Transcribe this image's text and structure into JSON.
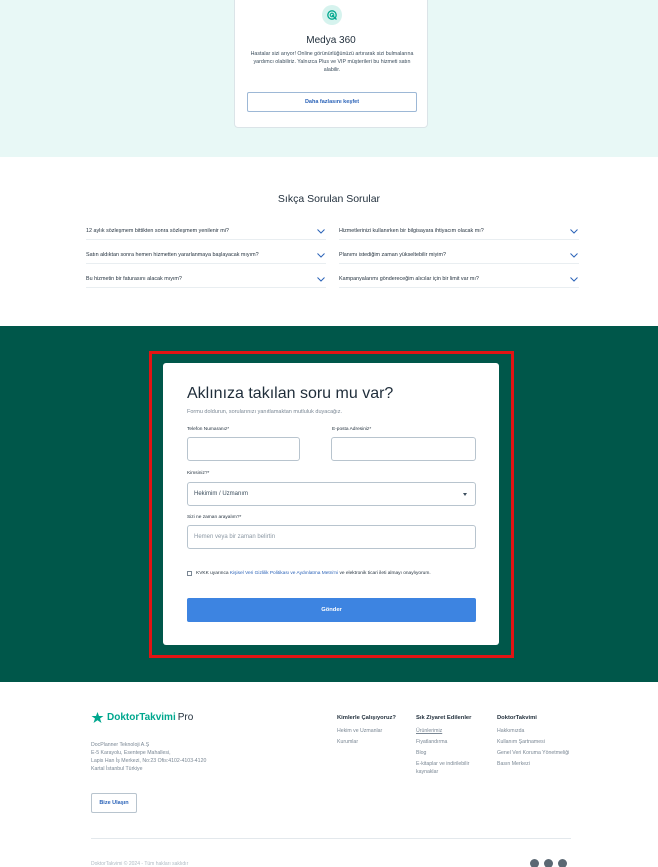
{
  "medya": {
    "icon": "radar-icon",
    "title": "Medya 360",
    "description": "Hastalar sizi arıyor! Online görünürlüğünüzü artırarak sizi bulmalarına yardımcı olabiliriz. Yalnızca Plus ve VIP müşterileri bu hizmeti satın alabilir.",
    "button": "Daha fazlasını keşfet"
  },
  "faq": {
    "title": "Sıkça Sorulan Sorular",
    "left": [
      "12 aylık sözleşmem bittikten sonra sözleşmem yenilenir mi?",
      "Satın aldıktan sonra hemen hizmetten yararlanmaya başlayacak mıyım?",
      "Bu hizmetin bir faturasını alacak mıyım?"
    ],
    "right": [
      "Hizmetlerinizi kullanırken bir bilgisayara ihtiyacım olacak mı?",
      "Planımı istediğim zaman yükseltebilir miyim?",
      "Kampanyalarımı göndereceğim alıcılar için bir limit var mı?"
    ]
  },
  "form": {
    "title": "Aklınıza takılan soru mu var?",
    "subtitle": "Formu doldurun, sorularınızı yanıtlamaktan mutluluk duyacağız.",
    "phone_label": "Telefon Numaranız*",
    "email_label": "E-posta Adresiniz*",
    "phone_value": "",
    "email_value": "",
    "who_label": "Kimsiniz?*",
    "who_value": "Hekimim / Uzmanım",
    "when_label": "Sizi ne zaman arayalım?*",
    "when_placeholder": "Hemen veya bir zaman belirtin",
    "kvkk_prefix": "KVKK uyarınca",
    "kvkk_link": "Kişisel Veri Gizlilik Politikası ve Aydınlatma Metni'ni",
    "kvkk_suffix": "ve elektronik ticari ileti almayı onaylıyorum.",
    "submit": "Gönder"
  },
  "footer": {
    "brand": "DoktorTakvimi",
    "brand_suffix": "Pro",
    "address": [
      "DocPlanner Teknoloji A.Ş",
      "E-5 Karayolu, Esentepe Mahallesi,",
      "Lapis Han İş Merkezi, No:23 Ofis:4102-4103-4120",
      "Kartal İstanbul Türkiye"
    ],
    "contact_button": "Bize Ulaşın",
    "col1": {
      "title": "Kimlerle Çalışıyoruz?",
      "items": [
        "Hekim ve Uzmanlar",
        "Kurumlar"
      ]
    },
    "col2": {
      "title": "Sık Ziyaret Edilenler",
      "items": [
        "Ürünlerimiz",
        "Fiyatlandırma",
        "Blog",
        "E-kitaplar ve indirilebilir kaynaklar"
      ]
    },
    "col3": {
      "title": "DoktorTakvimi",
      "items": [
        "Hakkımızda",
        "Kullanım Şartnamesi",
        "Genel Veri Koruma Yönetmeliği",
        "Basın Merkezi"
      ]
    },
    "copyright": "DoktorTakvimi © 2024 - Tüm hakları saklıdır"
  },
  "colors": {
    "accent": "#00a78e",
    "green_bg": "#00574a",
    "button_blue": "#3d84e1",
    "highlight": "#e11414"
  }
}
